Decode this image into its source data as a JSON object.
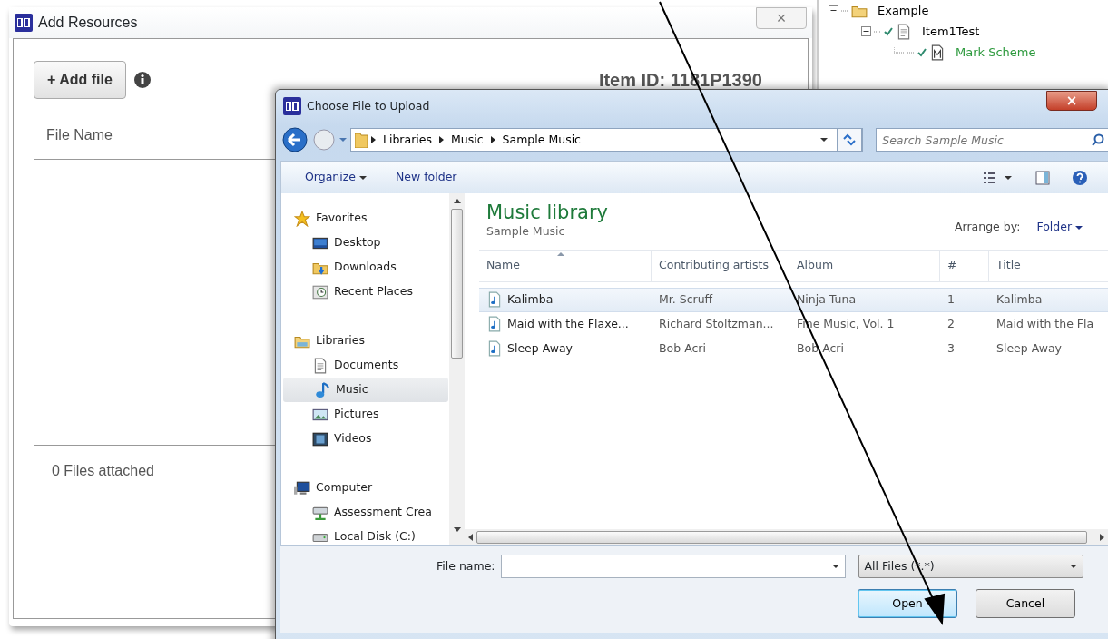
{
  "back_window": {
    "title": "Add Resources",
    "close": "×",
    "add_button": "+ Add file",
    "item_id": "Item ID: 1181P1390",
    "column": "File Name",
    "footer": "0 Files attached"
  },
  "tree": [
    {
      "label": "Example",
      "kind": "folder",
      "expanded": true,
      "checked": false,
      "color": "#000000",
      "children": [
        {
          "label": "Item1Test",
          "kind": "document",
          "expanded": true,
          "checked": true,
          "color": "#000000",
          "children": [
            {
              "label": "Mark Scheme",
              "kind": "mark",
              "checked": true,
              "color": "#2e9a3e"
            }
          ]
        }
      ]
    }
  ],
  "dialog": {
    "title": "Choose File to Upload",
    "close": "×",
    "breadcrumb": [
      "Libraries",
      "Music",
      "Sample Music"
    ],
    "search": {
      "placeholder": "Search Sample Music"
    },
    "toolbar": {
      "organize": "Organize",
      "new_folder": "New folder"
    },
    "nav": [
      {
        "label": "Favorites",
        "kind": "star",
        "children": [
          {
            "label": "Desktop",
            "kind": "desktop",
            "selected": false
          },
          {
            "label": "Downloads",
            "kind": "downloads",
            "selected": false
          },
          {
            "label": "Recent Places",
            "kind": "recent",
            "selected": false
          }
        ]
      },
      {
        "label": "Libraries",
        "kind": "library",
        "children": [
          {
            "label": "Documents",
            "kind": "document",
            "selected": false
          },
          {
            "label": "Music",
            "kind": "music",
            "selected": true
          },
          {
            "label": "Pictures",
            "kind": "pictures",
            "selected": false
          },
          {
            "label": "Videos",
            "kind": "videos",
            "selected": false
          }
        ]
      },
      {
        "label": "Computer",
        "kind": "computer",
        "children": [
          {
            "label": "Assessment Crea",
            "kind": "netdrive",
            "selected": false
          },
          {
            "label": "Local Disk (C:)",
            "kind": "disk",
            "selected": false
          }
        ]
      }
    ],
    "library": {
      "title": "Music library",
      "subtitle": "Sample Music",
      "arrange_label": "Arrange by:",
      "arrange_value": "Folder"
    },
    "table": {
      "columns": [
        "Name",
        "Contributing artists",
        "Album",
        "#",
        "Title"
      ],
      "rows": [
        {
          "cells": [
            "Kalimba",
            "Mr. Scruff",
            "Ninja Tuna",
            "1",
            "Kalimba"
          ],
          "selected": true
        },
        {
          "cells": [
            "Maid with the Flaxe...",
            "Richard Stoltzman...",
            "Fine Music, Vol. 1",
            "2",
            "Maid with the Fla"
          ],
          "selected": false
        },
        {
          "cells": [
            "Sleep Away",
            "Bob Acri",
            "Bob Acri",
            "3",
            "Sleep Away"
          ],
          "selected": false
        }
      ]
    },
    "file_name_label": "File name:",
    "filter": "All Files (*.*)",
    "buttons": [
      {
        "label": "Open",
        "default": true
      },
      {
        "label": "Cancel",
        "default": false
      }
    ]
  }
}
